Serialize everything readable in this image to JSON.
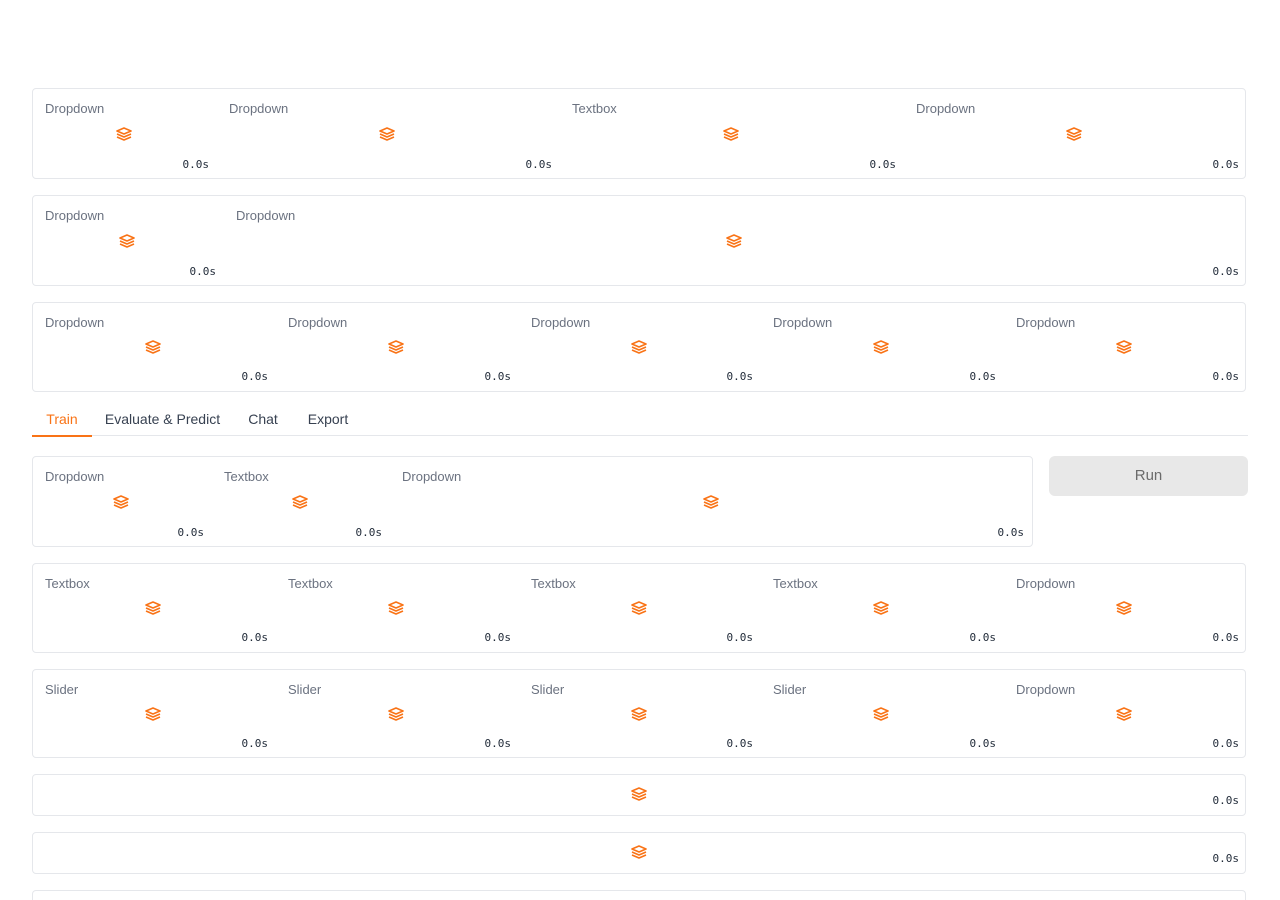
{
  "accent_color": "#f97316",
  "rows": [
    {
      "cells": [
        {
          "label": "Dropdown",
          "timer": "0.0s"
        },
        {
          "label": "Dropdown",
          "timer": "0.0s"
        },
        {
          "label": "Textbox",
          "timer": "0.0s"
        },
        {
          "label": "Dropdown",
          "timer": "0.0s"
        }
      ]
    },
    {
      "cells": [
        {
          "label": "Dropdown",
          "timer": "0.0s"
        },
        {
          "label": "Dropdown",
          "timer": "0.0s"
        }
      ]
    },
    {
      "cells": [
        {
          "label": "Dropdown",
          "timer": "0.0s"
        },
        {
          "label": "Dropdown",
          "timer": "0.0s"
        },
        {
          "label": "Dropdown",
          "timer": "0.0s"
        },
        {
          "label": "Dropdown",
          "timer": "0.0s"
        },
        {
          "label": "Dropdown",
          "timer": "0.0s"
        }
      ]
    },
    {
      "cells": [
        {
          "label": "Dropdown",
          "timer": "0.0s"
        },
        {
          "label": "Textbox",
          "timer": "0.0s"
        },
        {
          "label": "Dropdown",
          "timer": "0.0s"
        }
      ]
    },
    {
      "cells": [
        {
          "label": "Textbox",
          "timer": "0.0s"
        },
        {
          "label": "Textbox",
          "timer": "0.0s"
        },
        {
          "label": "Textbox",
          "timer": "0.0s"
        },
        {
          "label": "Textbox",
          "timer": "0.0s"
        },
        {
          "label": "Dropdown",
          "timer": "0.0s"
        }
      ]
    },
    {
      "cells": [
        {
          "label": "Slider",
          "timer": "0.0s"
        },
        {
          "label": "Slider",
          "timer": "0.0s"
        },
        {
          "label": "Slider",
          "timer": "0.0s"
        },
        {
          "label": "Slider",
          "timer": "0.0s"
        },
        {
          "label": "Dropdown",
          "timer": "0.0s"
        }
      ]
    },
    {
      "cells": [
        {
          "label": "",
          "timer": "0.0s"
        }
      ]
    },
    {
      "cells": [
        {
          "label": "",
          "timer": "0.0s"
        }
      ]
    }
  ],
  "tabs": [
    {
      "label": "Train",
      "active": true
    },
    {
      "label": "Evaluate & Predict",
      "active": false
    },
    {
      "label": "Chat",
      "active": false
    },
    {
      "label": "Export",
      "active": false
    }
  ],
  "run_button": {
    "label": "Run"
  },
  "loading_icon": "loading-spinner-icon"
}
